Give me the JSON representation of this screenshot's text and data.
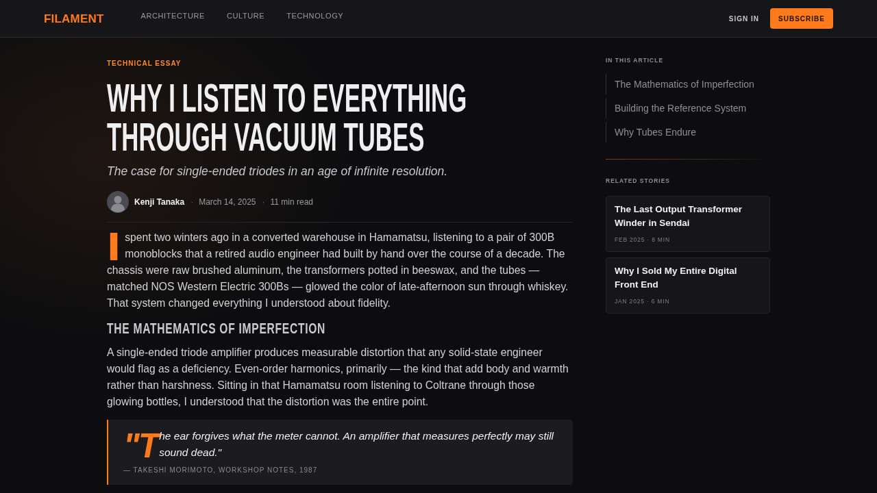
{
  "header": {
    "logo": "FILAMENT",
    "nav": [
      {
        "label": "ARCHITECTURE"
      },
      {
        "label": "CULTURE"
      },
      {
        "label": "TECHNOLOGY"
      }
    ],
    "sign_in": "SIGN IN",
    "subscribe": "SUBSCRIBE"
  },
  "article": {
    "kicker": "TECHNICAL ESSAY",
    "title": "WHY I LISTEN TO EVERYTHING THROUGH VACUUM TUBES",
    "subtitle": "The case for single-ended triodes in an age of infinite resolution.",
    "author": {
      "name": "Kenji Tanaka",
      "details": [
        {
          "separator": "·",
          "text": "March 14, 2025"
        },
        {
          "separator": "·",
          "text": "11 min read"
        }
      ]
    },
    "body": [
      {
        "kind": "paragraph",
        "drop_cap": "I",
        "text": "spent two winters ago in a converted warehouse in Hamamatsu, listening to a pair of 300B monoblocks that a retired audio engineer had built by hand over the course of a decade. The chassis were raw brushed aluminum, the transformers potted in beeswax, and the tubes — matched NOS Western Electric 300Bs — glowed the color of late-afternoon sun through whiskey. That system changed everything I understood about fidelity."
      },
      {
        "kind": "heading",
        "text": "THE MATHEMATICS OF IMPERFECTION"
      },
      {
        "kind": "paragraph",
        "text": "A single-ended triode amplifier produces measurable distortion that any solid-state engineer would flag as a deficiency. Even-order harmonics, primarily — the kind that add body and warmth rather than harshness. Sitting in that Hamamatsu room listening to Coltrane through those glowing bottles, I understood that the distortion was the entire point."
      },
      {
        "kind": "quote",
        "drop_cap": "\"T",
        "text": "he ear forgives what the meter cannot. An amplifier that measures perfectly may still sound dead.\"",
        "attribution": "— TAKESHI MORIMOTO, WORKSHOP NOTES, 1987"
      }
    ]
  },
  "sidebar": {
    "toc_heading": "IN THIS ARTICLE",
    "toc": [
      {
        "label": "The Mathematics of Imperfection"
      },
      {
        "label": "Building the Reference System"
      },
      {
        "label": "Why Tubes Endure"
      }
    ],
    "related_heading": "RELATED STORIES",
    "related": [
      {
        "title": "The Last Output Transformer Winder in Sendai",
        "meta": "FEB 2025 · 8 MIN"
      },
      {
        "title": "Why I Sold My Entire Digital Front End",
        "meta": "JAN 2025 · 6 MIN"
      }
    ]
  }
}
